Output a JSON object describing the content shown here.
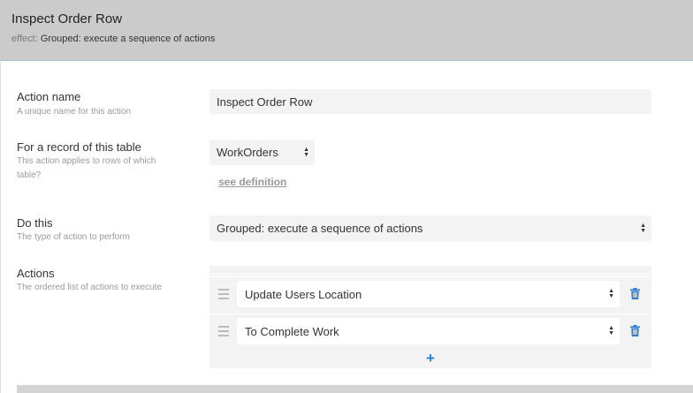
{
  "header": {
    "title": "Inspect Order Row",
    "effect_label": "effect:",
    "effect_value": "Grouped: execute a sequence of actions"
  },
  "fields": {
    "action_name": {
      "label": "Action name",
      "description": "A unique name for this action",
      "value": "Inspect Order Row"
    },
    "table": {
      "label": "For a record of this table",
      "description": "This action applies to rows of which table?",
      "value": "WorkOrders",
      "link": "see definition"
    },
    "do_this": {
      "label": "Do this",
      "description": "The type of action to perform",
      "value": "Grouped: execute a sequence of actions"
    },
    "actions": {
      "label": "Actions",
      "description": "The ordered list of actions to execute",
      "items": [
        {
          "value": "Update Users Location"
        },
        {
          "value": "To Complete Work"
        }
      ],
      "add_label": "+"
    }
  },
  "colors": {
    "header_bg": "#cbcbcb",
    "accent": "#2a7fd4",
    "field_bg": "#f3f3f3"
  }
}
